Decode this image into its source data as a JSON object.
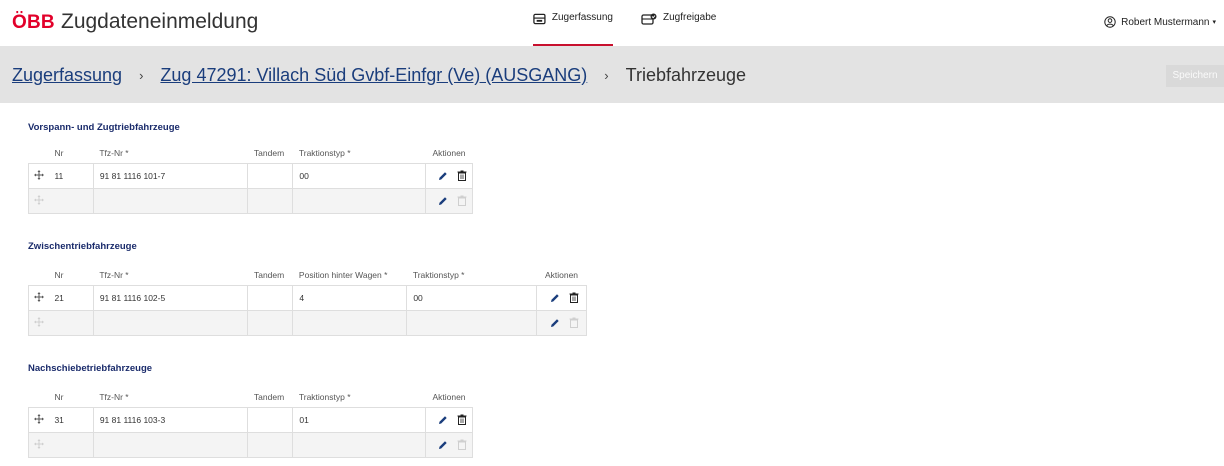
{
  "header": {
    "logo": "ÖBB",
    "app_title": "Zugdateneinmeldung",
    "tabs": [
      {
        "label": "Zugerfassung",
        "icon": "train-form-icon",
        "active": true
      },
      {
        "label": "Zugfreigabe",
        "icon": "train-release-icon",
        "active": false
      }
    ],
    "user": {
      "name": "Robert Mustermann",
      "icon": "user-circle-icon"
    }
  },
  "breadcrumb": {
    "items": [
      {
        "label": "Zugerfassung",
        "link": true
      },
      {
        "label": "Zug 47291: Villach Süd Gvbf-Einfgr (Ve) (AUSGANG)",
        "link": true
      },
      {
        "label": "Triebfahrzeuge",
        "link": false
      }
    ],
    "separator": "›",
    "save_label": "Speichern"
  },
  "sections": [
    {
      "title": "Vorspann- und Zugtriebfahrzeuge",
      "columns": [
        "Nr",
        "Tfz-Nr *",
        "Tandem",
        "Traktionstyp *",
        "Aktionen"
      ],
      "rows": [
        {
          "nr": "11",
          "tfz": "91 81 1116 101-7",
          "tandem": "",
          "traktion": "00"
        }
      ]
    },
    {
      "title": "Zwischentriebfahrzeuge",
      "columns": [
        "Nr",
        "Tfz-Nr *",
        "Tandem",
        "Position hinter Wagen *",
        "Traktionstyp *",
        "Aktionen"
      ],
      "rows": [
        {
          "nr": "21",
          "tfz": "91 81 1116 102-5",
          "tandem": "",
          "position": "4",
          "traktion": "00"
        }
      ]
    },
    {
      "title": "Nachschiebetriebfahrzeuge",
      "columns": [
        "Nr",
        "Tfz-Nr *",
        "Tandem",
        "Traktionstyp *",
        "Aktionen"
      ],
      "rows": [
        {
          "nr": "31",
          "tfz": "91 81 1116 103-3",
          "tandem": "",
          "traktion": "01"
        }
      ]
    }
  ],
  "colors": {
    "brand_red": "#e2002a",
    "link_blue": "#1a3d7c",
    "section_title": "#1a2b6b",
    "breadcrumb_bg": "#e3e3e3"
  }
}
